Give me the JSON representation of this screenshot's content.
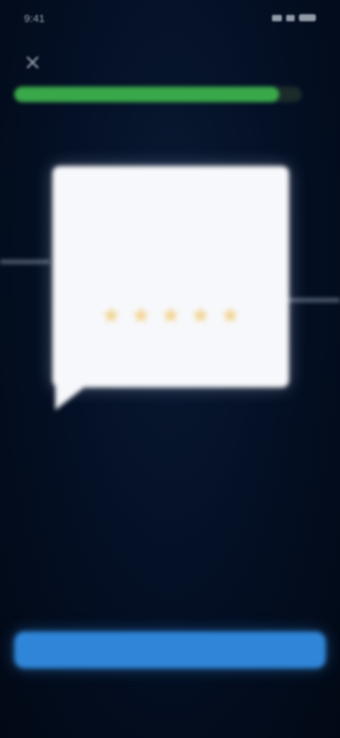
{
  "status_bar": {
    "time": "9:41",
    "icons": [
      "signal-icon",
      "wifi-icon",
      "battery-icon"
    ]
  },
  "header": {
    "close_icon": "close-icon",
    "progress_fraction": 0.92
  },
  "bubble": {
    "text": "",
    "subtext": "",
    "rating_max": 5,
    "star_icon": "star-icon"
  },
  "speaker_label": "",
  "footer": {
    "continue_label": ""
  },
  "colors": {
    "background": "#020b1c",
    "progress": "#39a84a",
    "button": "#2f86d8",
    "bubble": "#f7f8fb",
    "star": "#f3d79a"
  }
}
